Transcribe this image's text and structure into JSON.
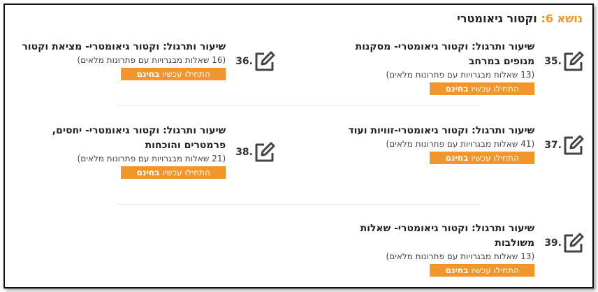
{
  "topic": {
    "prefix": "נושא 6:",
    "title": "וקטור גיאומטרי"
  },
  "items": [
    {
      "index": "35.",
      "title": "שיעור ותרגול: וקטור גיאומטרי- מסקנות מגופים במרחב",
      "subtitle": "(13 שאלות מבגרויות עם פתרונות מלאים)",
      "btn": "התחילו עכשיו",
      "btn_bold": "בחינם"
    },
    {
      "index": "36.",
      "title": "שיעור ותרגול: וקטור גיאומטרי- מציאת וקטור",
      "subtitle": "(16 שאלות מבגרויות עם פתרונות מלאים)",
      "btn": "התחילו עכשיו",
      "btn_bold": "בחינם"
    },
    {
      "index": "37.",
      "title": "שיעור ותרגול: וקטור גיאומטרי-זוויות ועוד",
      "subtitle": "(41 שאלות מבגרויות עם פתרונות מלאים)",
      "btn": "התחילו עכשיו",
      "btn_bold": "בחינם"
    },
    {
      "index": "38.",
      "title": "שיעור ותרגול: וקטור גיאומטרי- יחסים, פרמטרים והוכחות",
      "subtitle": "(21 שאלות מבגרויות עם פתרונות מלאים)",
      "btn": "התחילו עכשיו",
      "btn_bold": "בחינם"
    },
    {
      "index": "39.",
      "title": "שיעור ותרגול: וקטור גיאומטרי- שאלות משולבות",
      "subtitle": "(13 שאלות מבגרויות עם פתרונות מלאים)",
      "btn": "התחילו עכשיו",
      "btn_bold": "בחינם"
    }
  ],
  "colors": {
    "accent": "#f0962a",
    "text": "#222222"
  },
  "icons": {
    "item_icon": "edit-pencil-icon"
  }
}
